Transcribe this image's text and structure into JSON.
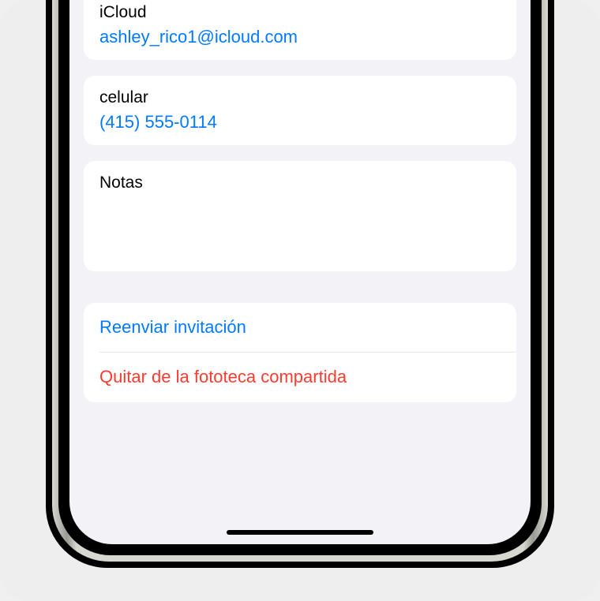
{
  "contact": {
    "icloud": {
      "label": "iCloud",
      "value": "ashley_rico1@icloud.com"
    },
    "phone": {
      "label": "celular",
      "value": "(415) 555-0114"
    },
    "notes": {
      "label": "Notas"
    }
  },
  "actions": {
    "resend": "Reenviar invitación",
    "remove": "Quitar de la fototeca compartida"
  }
}
